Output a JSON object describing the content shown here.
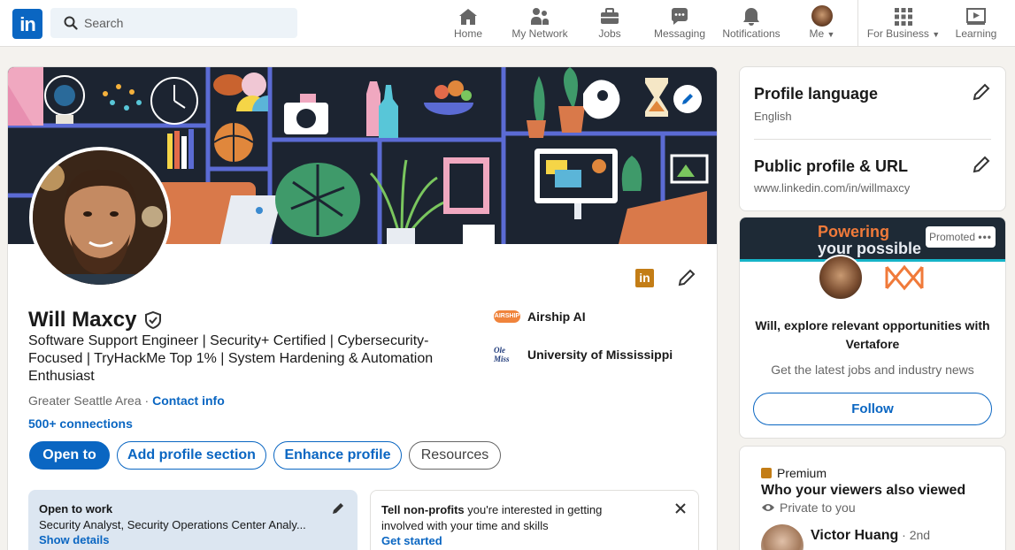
{
  "nav": {
    "logo": "in",
    "search_placeholder": "Search",
    "items": [
      {
        "label": "Home",
        "icon": "home-icon"
      },
      {
        "label": "My Network",
        "icon": "network-icon"
      },
      {
        "label": "Jobs",
        "icon": "briefcase-icon"
      },
      {
        "label": "Messaging",
        "icon": "messaging-icon"
      },
      {
        "label": "Notifications",
        "icon": "bell-icon"
      },
      {
        "label": "Me",
        "icon": "avatar"
      },
      {
        "label": "For Business",
        "icon": "grid-icon"
      },
      {
        "label": "Learning",
        "icon": "learning-icon"
      }
    ]
  },
  "profile": {
    "name": "Will Maxcy",
    "headline": "Software Support Engineer | Security+ Certified | Cybersecurity-Focused | TryHackMe Top 1% | System Hardening & Automation Enthusiast",
    "location": "Greater Seattle Area",
    "separator": " · ",
    "contact_info": "Contact info",
    "connections": "500+ connections",
    "company": "Airship AI",
    "company_logo_text": "AIRSHIP",
    "school": "University of Mississippi",
    "school_logo_text": "Ole Miss",
    "buttons": {
      "open_to": "Open to",
      "add_section": "Add profile section",
      "enhance": "Enhance profile",
      "resources": "Resources"
    },
    "open_to_work": {
      "title": "Open to work",
      "roles": "Security Analyst, Security Operations Center Analy...",
      "link": "Show details"
    },
    "nonprofit": {
      "bold": "Tell non-profits",
      "text": " you're interested in getting involved with your time and skills",
      "link": "Get started"
    }
  },
  "sidebar": {
    "language_title": "Profile language",
    "language_value": "English",
    "url_title": "Public profile & URL",
    "url_value": "www.linkedin.com/in/willmaxcy"
  },
  "ad": {
    "banner_line1": "Powering",
    "banner_line2": "your possible",
    "promoted": "Promoted",
    "headline": "Will, explore relevant opportunities with Vertafore",
    "sub": "Get the latest jobs and industry news",
    "follow": "Follow"
  },
  "premium": {
    "label": "Premium",
    "title": "Who your viewers also viewed",
    "private": "Private to you",
    "viewer_name": "Victor Huang",
    "viewer_degree": " · 2nd"
  },
  "colors": {
    "brand": "#0a66c2",
    "page_bg": "#f4f2ee",
    "open_to_work_bg": "#dce6f1",
    "premium_gold": "#c37d16"
  }
}
